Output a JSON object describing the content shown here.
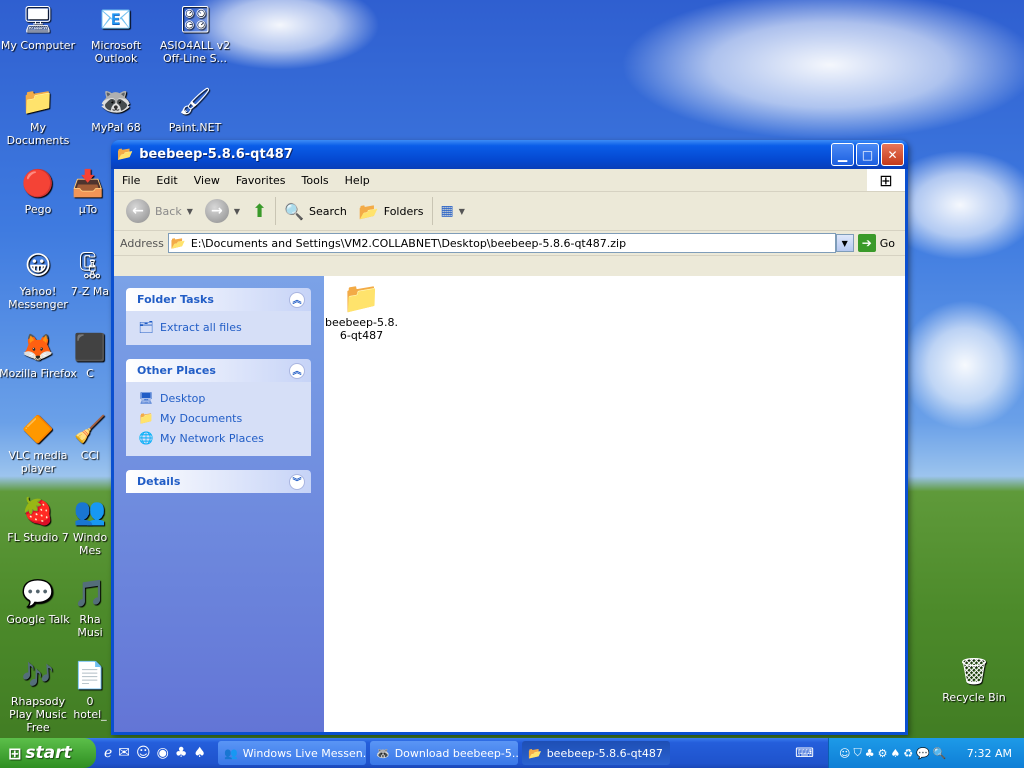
{
  "desktop": {
    "icons": [
      {
        "label": "My Computer",
        "glyph": "🖥"
      },
      {
        "label": "Microsoft Outlook",
        "glyph": "📧"
      },
      {
        "label": "ASIO4ALL v2 Off-Line S...",
        "glyph": "🎛"
      },
      {
        "label": "My Documents",
        "glyph": "📁"
      },
      {
        "label": "MyPal 68",
        "glyph": "🦝"
      },
      {
        "label": "Paint.NET",
        "glyph": "🖌"
      },
      {
        "label": "Pego",
        "glyph": "🔴"
      },
      {
        "label": "µTo",
        "glyph": "📥"
      },
      {
        "label": "Yahoo! Messenger",
        "glyph": "😀"
      },
      {
        "label": "7-Z Ma",
        "glyph": "🗜"
      },
      {
        "label": "Mozilla Firefox",
        "glyph": "🦊"
      },
      {
        "label": "C",
        "glyph": "⬛"
      },
      {
        "label": "VLC media player",
        "glyph": "🔶"
      },
      {
        "label": "CCl",
        "glyph": "🧹"
      },
      {
        "label": "FL Studio 7",
        "glyph": "🍓"
      },
      {
        "label": "Windo Mes",
        "glyph": "👥"
      },
      {
        "label": "Google Talk",
        "glyph": "💬"
      },
      {
        "label": "Rha Musi",
        "glyph": "🎵"
      },
      {
        "label": "Rhapsody Play Music Free",
        "glyph": "🎶"
      },
      {
        "label": "0 hotel_",
        "glyph": "📄"
      },
      {
        "label": "Recycle Bin",
        "glyph": "🗑"
      }
    ]
  },
  "window": {
    "title": "beebeep-5.8.6-qt487",
    "menu": [
      "File",
      "Edit",
      "View",
      "Favorites",
      "Tools",
      "Help"
    ],
    "toolbar": {
      "back": "Back",
      "search": "Search",
      "folders": "Folders"
    },
    "address": {
      "label": "Address",
      "value": "E:\\Documents and Settings\\VM2.COLLABNET\\Desktop\\beebeep-5.8.6-qt487.zip",
      "go": "Go"
    },
    "folder_tasks": {
      "title": "Folder Tasks",
      "items": [
        "Extract all files"
      ]
    },
    "other_places": {
      "title": "Other Places",
      "items": [
        "Desktop",
        "My Documents",
        "My Network Places"
      ]
    },
    "details": {
      "title": "Details"
    },
    "files": [
      {
        "name_line1": "beebeep-5.8.",
        "name_line2": "6-qt487"
      }
    ]
  },
  "taskbar": {
    "start": "start",
    "buttons": [
      "Windows Live Messen...",
      "Download beebeep-5...",
      "beebeep-5.8.6-qt487"
    ],
    "clock": "7:32 AM"
  },
  "colors": {
    "title_blue": "#0548d0",
    "task_blue": "#215dc6",
    "start_green": "#3a9a2a"
  }
}
